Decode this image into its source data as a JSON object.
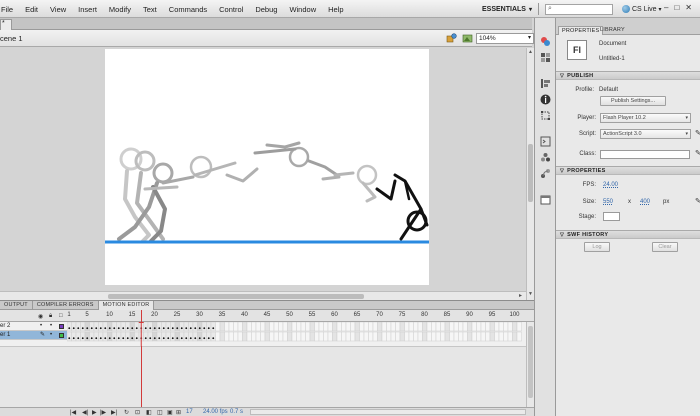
{
  "menubar": {
    "items": [
      "File",
      "Edit",
      "View",
      "Insert",
      "Modify",
      "Text",
      "Commands",
      "Control",
      "Debug",
      "Window",
      "Help"
    ],
    "workspace": "ESSENTIALS",
    "cs_live": "CS Live"
  },
  "document": {
    "tab_label": "*",
    "scene": "cene 1",
    "zoom": "104%"
  },
  "bottom_tabs": [
    "OUTPUT",
    "COMPILER ERRORS",
    "MOTION EDITOR"
  ],
  "timeline": {
    "ruler_labels": [
      "1",
      "5",
      "10",
      "15",
      "20",
      "25",
      "30",
      "35",
      "40",
      "45",
      "50",
      "55",
      "60",
      "65",
      "70",
      "75",
      "80",
      "85",
      "90",
      "95",
      "100"
    ],
    "playhead_frame": 17,
    "layers": [
      {
        "name": "er 2",
        "color": "#7a3fbf"
      },
      {
        "name": "er 1",
        "color": "#3fbf4a",
        "selected": true
      }
    ],
    "status": {
      "frame": "17",
      "fps": "24.00 fps",
      "time": "0.7 s"
    }
  },
  "properties": {
    "tabs": [
      "PROPERTIES",
      "LIBRARY"
    ],
    "doc_icon": "Fl",
    "doc_type": "Document",
    "doc_name": "Untitled-1",
    "publish_section": "PUBLISH",
    "profile_label": "Profile:",
    "profile_value": "Default",
    "publish_settings_button": "Publish Settings...",
    "player_label": "Player:",
    "player_value": "Flash Player 10.2",
    "script_label": "Script:",
    "script_value": "ActionScript 3.0",
    "class_label": "Class:",
    "properties_section": "PROPERTIES",
    "fps_label": "FPS:",
    "fps_value": "24.00",
    "size_label": "Size:",
    "width_value": "550",
    "x_label": "x",
    "height_value": "400",
    "px_label": "px",
    "stage_label": "Stage:",
    "stage_color": "#ffffff",
    "swf_history_section": "SWF HISTORY",
    "log_button": "Log",
    "clear_button": "Clear"
  },
  "colors": {
    "ground_line": "#2a8ae0",
    "playhead": "#d23a3a",
    "accent_blue": "#3166aa"
  }
}
